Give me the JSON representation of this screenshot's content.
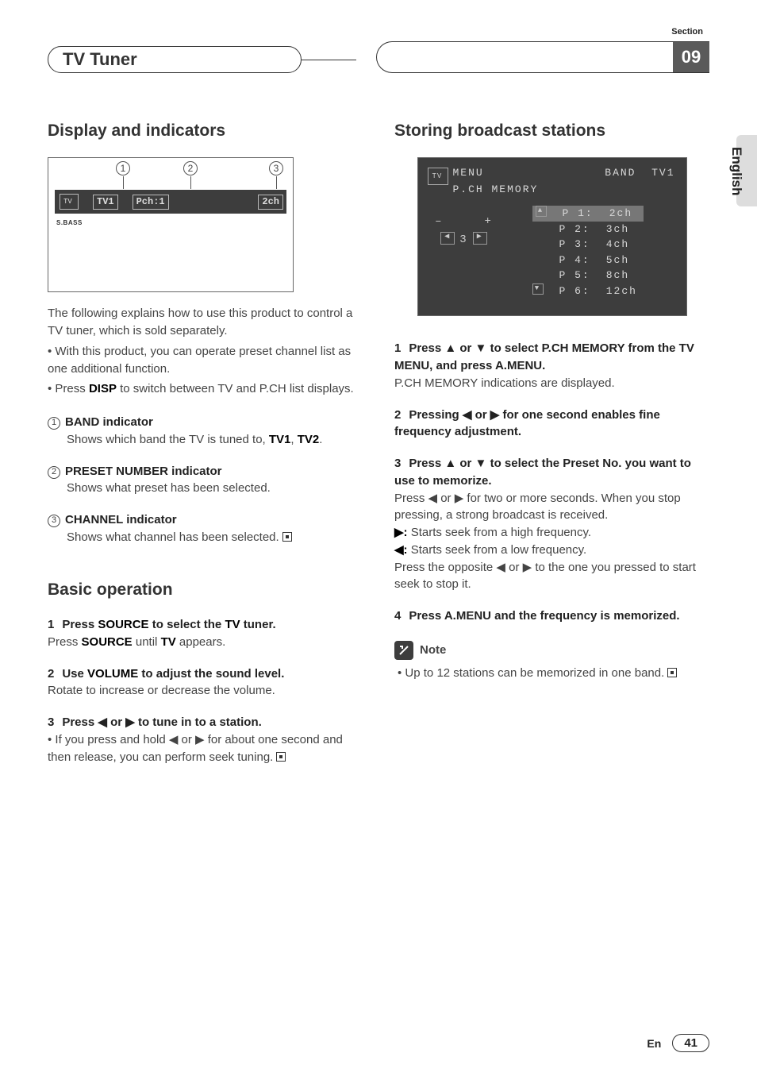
{
  "header": {
    "section_label": "Section",
    "title": "TV Tuner",
    "section_number": "09"
  },
  "side": {
    "language": "English"
  },
  "left": {
    "h_display": "Display and indicators",
    "lcd": {
      "band": "TV1",
      "preset": "Pch:1",
      "channel": "2ch",
      "sbass": "S.BASS"
    },
    "callouts": {
      "c1": "1",
      "c2": "2",
      "c3": "3"
    },
    "intro1": "The following explains how to use this product to control a TV tuner, which is sold separately.",
    "intro2_pre": "• With this product, you can operate preset channel list as one additional function.",
    "intro3_pre": "• Press ",
    "intro3_b": "DISP",
    "intro3_post": " to switch between TV and P.CH list displays.",
    "defs": [
      {
        "num": "1",
        "title": "BAND indicator",
        "body_pre": "Shows which band the TV is tuned to, ",
        "b1": "TV1",
        "mid": ", ",
        "b2": "TV2",
        "post": "."
      },
      {
        "num": "2",
        "title": "PRESET NUMBER indicator",
        "body": "Shows what preset has been selected."
      },
      {
        "num": "3",
        "title": "CHANNEL indicator",
        "body": "Shows what channel has been selected."
      }
    ],
    "h_basic": "Basic operation",
    "steps": [
      {
        "num": "1",
        "head_pre": "Press ",
        "head_b1": "SOURCE",
        "head_mid": " to select the ",
        "head_b2": "TV",
        "head_post": " tuner.",
        "body_pre": "Press ",
        "body_b": "SOURCE",
        "body_mid": " until ",
        "body_b2": "TV",
        "body_post": " appears."
      },
      {
        "num": "2",
        "head_pre": "Use ",
        "head_b1": "VOLUME",
        "head_post": " to adjust the sound level.",
        "body": "Rotate to increase or decrease the volume."
      },
      {
        "num": "3",
        "head": "Press ◀ or ▶ to tune in to a station.",
        "body": "• If you press and hold ◀ or ▶ for about one second and then release, you can perform seek tuning."
      }
    ]
  },
  "right": {
    "h_storing": "Storing broadcast stations",
    "menu": {
      "menu_label": "MENU",
      "band_label": "BAND",
      "band_value": "TV1",
      "pch_label": "P.CH MEMORY",
      "dpad_value": "3",
      "rows": [
        {
          "p": "P  1:",
          "ch": "2ch"
        },
        {
          "p": "P  2:",
          "ch": "3ch"
        },
        {
          "p": "P  3:",
          "ch": "4ch"
        },
        {
          "p": "P  4:",
          "ch": "5ch"
        },
        {
          "p": "P  5:",
          "ch": "8ch"
        },
        {
          "p": "P  6:",
          "ch": "12ch"
        }
      ]
    },
    "step1_head": "Press ▲ or ▼ to select P.CH MEMORY from the TV MENU, and press A.MENU.",
    "step1_body": "P.CH MEMORY indications are displayed.",
    "step2_head": "Pressing ◀ or ▶ for one second enables fine frequency adjustment.",
    "step3_head": "Press ▲ or ▼ to select the Preset No. you want to use to memorize.",
    "step3_body1": "Press ◀ or ▶ for two or more seconds. When you stop pressing, a strong broadcast is received.",
    "step3_r": "▶: Starts seek from a high frequency.",
    "step3_l": "◀: Starts seek from a low frequency.",
    "step3_body2": "Press the opposite ◀ or ▶ to the one you pressed to start seek to stop it.",
    "step4_head": "Press A.MENU and the frequency is memorized.",
    "note_label": "Note",
    "note_body": "• Up to 12 stations can be memorized in one band."
  },
  "footer": {
    "lang": "En",
    "page": "41"
  }
}
